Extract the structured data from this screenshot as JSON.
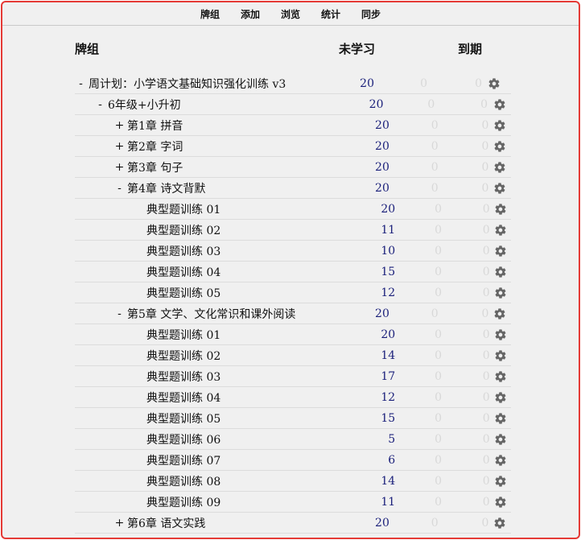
{
  "nav": [
    {
      "label": "牌组",
      "name": "nav-decks"
    },
    {
      "label": "添加",
      "name": "nav-add"
    },
    {
      "label": "浏览",
      "name": "nav-browse"
    },
    {
      "label": "统计",
      "name": "nav-stats"
    },
    {
      "label": "同步",
      "name": "nav-sync"
    }
  ],
  "table": {
    "header": {
      "deck": "牌组",
      "new": "未学习",
      "due": "到期"
    }
  },
  "decks": [
    {
      "level": 0,
      "toggle": "-",
      "label": "周计划：小学语文基础知识强化训练 v3",
      "new": "20",
      "learn": "0",
      "due": "0"
    },
    {
      "level": 1,
      "toggle": "-",
      "label": "6年级+小升初",
      "new": "20",
      "learn": "0",
      "due": "0"
    },
    {
      "level": 2,
      "toggle": "+",
      "label": "第1章 拼音",
      "new": "20",
      "learn": "0",
      "due": "0"
    },
    {
      "level": 2,
      "toggle": "+",
      "label": "第2章 字词",
      "new": "20",
      "learn": "0",
      "due": "0"
    },
    {
      "level": 2,
      "toggle": "+",
      "label": "第3章 句子",
      "new": "20",
      "learn": "0",
      "due": "0"
    },
    {
      "level": 2,
      "toggle": "-",
      "label": "第4章 诗文背默",
      "new": "20",
      "learn": "0",
      "due": "0"
    },
    {
      "level": 3,
      "toggle": "",
      "label": "典型题训练 01",
      "new": "20",
      "learn": "0",
      "due": "0"
    },
    {
      "level": 3,
      "toggle": "",
      "label": "典型题训练 02",
      "new": "11",
      "learn": "0",
      "due": "0"
    },
    {
      "level": 3,
      "toggle": "",
      "label": "典型题训练 03",
      "new": "10",
      "learn": "0",
      "due": "0"
    },
    {
      "level": 3,
      "toggle": "",
      "label": "典型题训练 04",
      "new": "15",
      "learn": "0",
      "due": "0"
    },
    {
      "level": 3,
      "toggle": "",
      "label": "典型题训练 05",
      "new": "12",
      "learn": "0",
      "due": "0"
    },
    {
      "level": 2,
      "toggle": "-",
      "label": "第5章 文学、文化常识和课外阅读",
      "new": "20",
      "learn": "0",
      "due": "0"
    },
    {
      "level": 3,
      "toggle": "",
      "label": "典型题训练 01",
      "new": "20",
      "learn": "0",
      "due": "0"
    },
    {
      "level": 3,
      "toggle": "",
      "label": "典型题训练 02",
      "new": "14",
      "learn": "0",
      "due": "0"
    },
    {
      "level": 3,
      "toggle": "",
      "label": "典型题训练 03",
      "new": "17",
      "learn": "0",
      "due": "0"
    },
    {
      "level": 3,
      "toggle": "",
      "label": "典型题训练 04",
      "new": "12",
      "learn": "0",
      "due": "0"
    },
    {
      "level": 3,
      "toggle": "",
      "label": "典型题训练 05",
      "new": "15",
      "learn": "0",
      "due": "0"
    },
    {
      "level": 3,
      "toggle": "",
      "label": "典型题训练 06",
      "new": "5",
      "learn": "0",
      "due": "0"
    },
    {
      "level": 3,
      "toggle": "",
      "label": "典型题训练 07",
      "new": "6",
      "learn": "0",
      "due": "0"
    },
    {
      "level": 3,
      "toggle": "",
      "label": "典型题训练 08",
      "new": "14",
      "learn": "0",
      "due": "0"
    },
    {
      "level": 3,
      "toggle": "",
      "label": "典型题训练 09",
      "new": "11",
      "learn": "0",
      "due": "0"
    },
    {
      "level": 2,
      "toggle": "+",
      "label": "第6章 语文实践",
      "new": "20",
      "learn": "0",
      "due": "0"
    }
  ],
  "icons": {
    "options": "gear-icon"
  },
  "colors": {
    "new_count": "#1a1f7a",
    "zero_count": "#d8d8d8",
    "frame_border": "#e53935",
    "background": "#f0f0f0"
  }
}
